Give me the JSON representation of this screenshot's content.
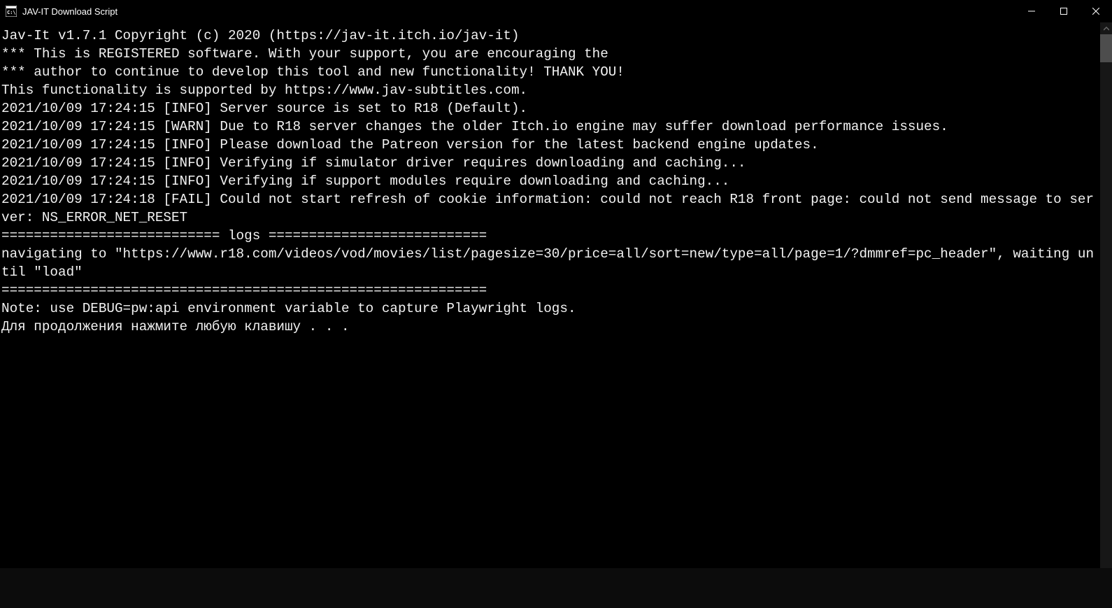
{
  "window": {
    "title": "JAV-IT Download Script"
  },
  "console": {
    "lines": [
      "Jav-It v1.7.1 Copyright (c) 2020 (https://jav-it.itch.io/jav-it)",
      "*** This is REGISTERED software. With your support, you are encouraging the",
      "*** author to continue to develop this tool and new functionality! THANK YOU!",
      "",
      "This functionality is supported by https://www.jav-subtitles.com.",
      "",
      "2021/10/09 17:24:15 [INFO] Server source is set to R18 (Default).",
      "2021/10/09 17:24:15 [WARN] Due to R18 server changes the older Itch.io engine may suffer download performance issues.",
      "2021/10/09 17:24:15 [INFO] Please download the Patreon version for the latest backend engine updates.",
      "2021/10/09 17:24:15 [INFO] Verifying if simulator driver requires downloading and caching...",
      "2021/10/09 17:24:15 [INFO] Verifying if support modules require downloading and caching...",
      "2021/10/09 17:24:18 [FAIL] Could not start refresh of cookie information: could not reach R18 front page: could not send message to server: NS_ERROR_NET_RESET",
      "=========================== logs ===========================",
      "navigating to \"https://www.r18.com/videos/vod/movies/list/pagesize=30/price=all/sort=new/type=all/page=1/?dmmref=pc_header\", waiting until \"load\"",
      "============================================================",
      "Note: use DEBUG=pw:api environment variable to capture Playwright logs.",
      "Для продолжения нажмите любую клавишу . . ."
    ]
  }
}
